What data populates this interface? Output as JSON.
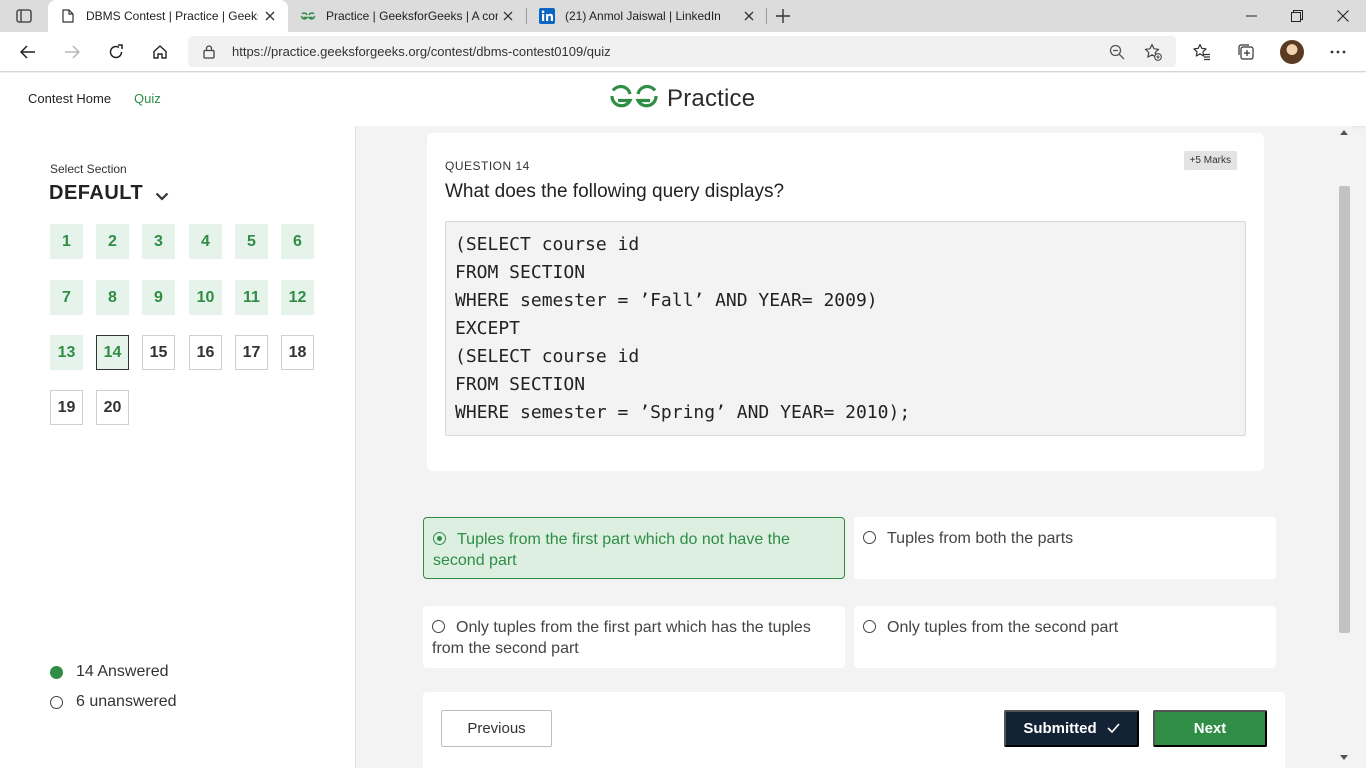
{
  "browser": {
    "tabs": [
      {
        "title": "DBMS Contest | Practice | GeeksforGeeks",
        "active": true,
        "favicon": "document-icon"
      },
      {
        "title": "Practice | GeeksforGeeks | A computer science portal",
        "active": false,
        "favicon": "gfg-icon"
      },
      {
        "title": "(21) Anmol Jaiswal | LinkedIn",
        "active": false,
        "favicon": "linkedin-icon"
      }
    ],
    "url": "https://practice.geeksforgeeks.org/contest/dbms-contest0109/quiz"
  },
  "header": {
    "links": [
      {
        "label": "Contest Home",
        "active": false
      },
      {
        "label": "Quiz",
        "active": true
      }
    ],
    "brand": "Practice",
    "accent_color": "#2f8d46"
  },
  "sidebar": {
    "select_label": "Select Section",
    "section": "DEFAULT",
    "questions": [
      {
        "num": "1",
        "state": "answered"
      },
      {
        "num": "2",
        "state": "answered"
      },
      {
        "num": "3",
        "state": "answered"
      },
      {
        "num": "4",
        "state": "answered"
      },
      {
        "num": "5",
        "state": "answered"
      },
      {
        "num": "6",
        "state": "answered"
      },
      {
        "num": "7",
        "state": "answered"
      },
      {
        "num": "8",
        "state": "answered"
      },
      {
        "num": "9",
        "state": "answered"
      },
      {
        "num": "10",
        "state": "answered"
      },
      {
        "num": "11",
        "state": "answered"
      },
      {
        "num": "12",
        "state": "answered"
      },
      {
        "num": "13",
        "state": "answered"
      },
      {
        "num": "14",
        "state": "current"
      },
      {
        "num": "15",
        "state": "unanswered"
      },
      {
        "num": "16",
        "state": "unanswered"
      },
      {
        "num": "17",
        "state": "unanswered"
      },
      {
        "num": "18",
        "state": "unanswered"
      },
      {
        "num": "19",
        "state": "unanswered"
      },
      {
        "num": "20",
        "state": "unanswered"
      }
    ],
    "answered_text": "14 Answered",
    "unanswered_text": "6 unanswered"
  },
  "question": {
    "number_label": "QUESTION 14",
    "marks": "+5 Marks",
    "text": "What does the following query displays?",
    "code": [
      "(SELECT course id",
      "FROM SECTION",
      "WHERE semester = ’Fall’ AND YEAR= 2009)",
      "EXCEPT",
      "(SELECT course id",
      "FROM SECTION",
      "WHERE semester = ’Spring’ AND YEAR= 2010);"
    ],
    "options": [
      {
        "text": "Tuples from the first part which do not have the second part",
        "selected": true
      },
      {
        "text": "Tuples from both the parts",
        "selected": false
      },
      {
        "text": "Only tuples from the first part which has the tuples from the second part",
        "selected": false
      },
      {
        "text": "Only tuples from the second part",
        "selected": false
      }
    ]
  },
  "footer": {
    "previous_label": "Previous",
    "submitted_label": "Submitted",
    "next_label": "Next"
  }
}
